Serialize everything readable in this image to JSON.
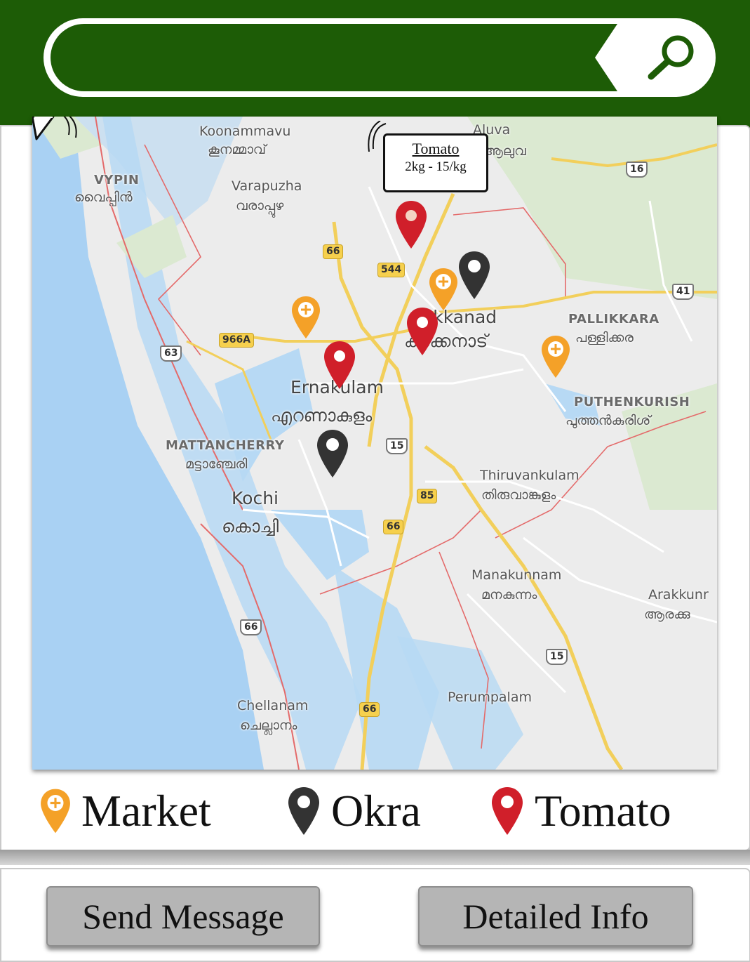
{
  "search": {
    "placeholder": "",
    "icon": "search-icon"
  },
  "map": {
    "labels": {
      "koonammavu": "Koonammavu",
      "koonammavu_ml": "കൂനമ്മാവ്",
      "aluva": "Aluva",
      "aluva_ml": "ആലുവ",
      "vypin": "VYPIN",
      "vypin_ml": "വൈപ്പിൻ",
      "varapuzha": "Varapuzha",
      "varapuzha_ml": "വരാപ്പുഴ",
      "kakkanad": "Kakkanad",
      "kakkanad_ml": "കാക്കനാട്",
      "pallikkara": "PALLIKKARA",
      "pallikkara_ml": "പള്ളിക്കര",
      "ernakulam": "Ernakulam",
      "ernakulam_ml": "എറണാകുളം",
      "puthenkurish": "PUTHENKURISH",
      "puthenkurish_ml": "പുത്തൻകുരിശ്",
      "mattancherry": "MATTANCHERRY",
      "mattancherry_ml": "മട്ടാഞ്ചേരി",
      "thiruvankulam": "Thiruvankulam",
      "thiruvankulam_ml": "തിരുവാങ്കുളം",
      "kochi": "Kochi",
      "kochi_ml": "കൊച്ചി",
      "manakunnam": "Manakunnam",
      "manakunnam_ml": "മനകുന്നം",
      "arakkunnam": "Arakkunr",
      "arakkunnam_ml": "ആരക്കു",
      "chellanam": "Chellanam",
      "chellanam_ml": "ചെല്ലാനം",
      "perumpalam": "Perumpalam"
    },
    "routes": {
      "r16": "16",
      "r66a": "66",
      "r544": "544",
      "r41": "41",
      "r966a": "966A",
      "r63": "63",
      "r15a": "15",
      "r85": "85",
      "r66b": "66",
      "r66c": "66",
      "r15b": "15",
      "r66d": "66"
    },
    "tooltip": {
      "title": "Tomato",
      "value": "2kg - 15/kg"
    }
  },
  "legend": {
    "market": "Market",
    "okra": "Okra",
    "tomato": "Tomato"
  },
  "colors": {
    "header_green": "#1d5c06",
    "market": "#f4a128",
    "okra": "#333333",
    "tomato": "#d01f2a"
  },
  "actions": {
    "send_message": "Send Message",
    "detailed_info": "Detailed Info"
  }
}
